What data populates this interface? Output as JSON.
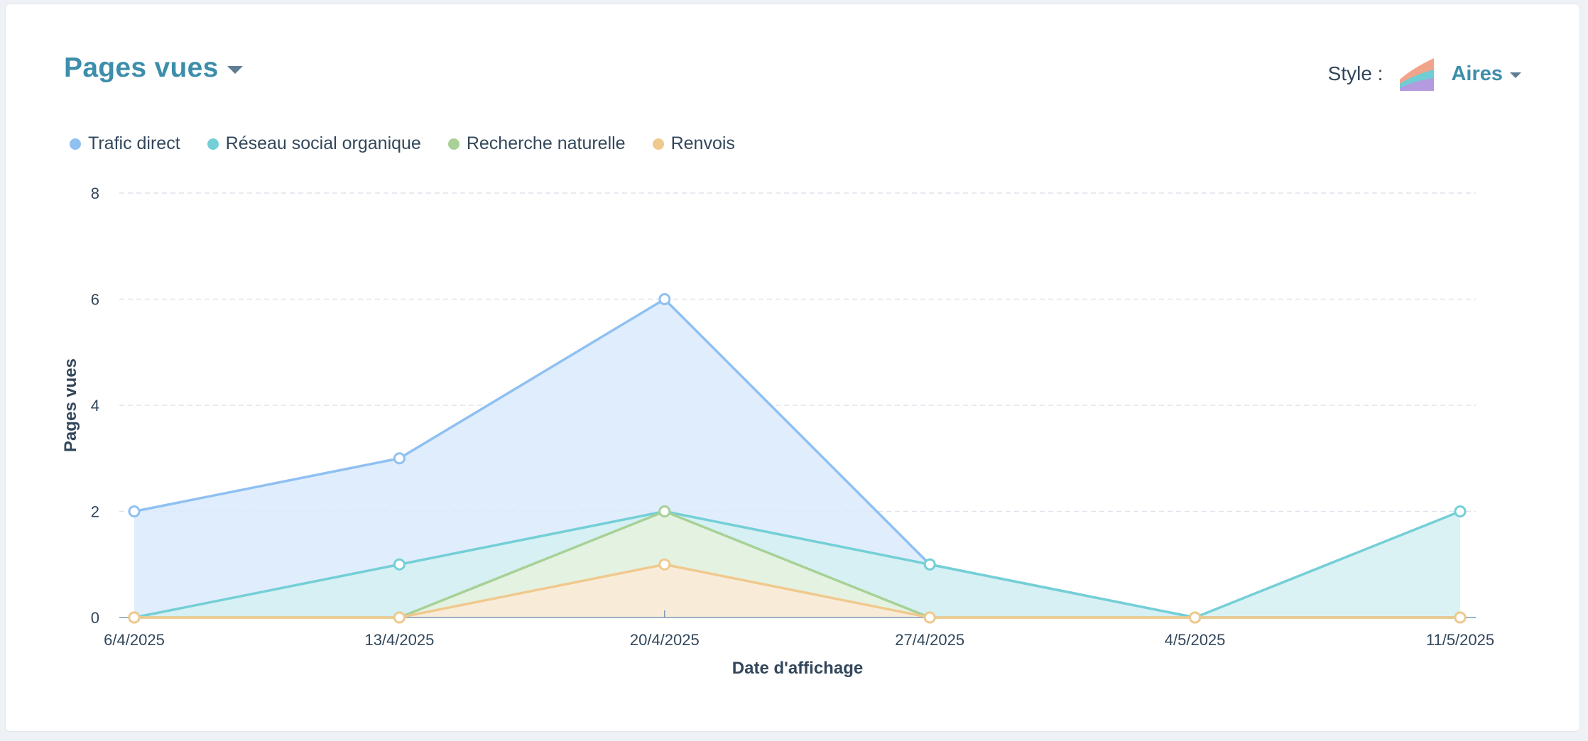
{
  "header": {
    "title": "Pages vues",
    "style_label": "Style :",
    "style_value": "Aires",
    "style_icon": "stacked-area-icon"
  },
  "chart_data": {
    "type": "area",
    "xlabel": "Date d'affichage",
    "ylabel": "Pages vues",
    "categories": [
      "6/4/2025",
      "13/4/2025",
      "20/4/2025",
      "27/4/2025",
      "4/5/2025",
      "11/5/2025"
    ],
    "ylim": [
      0,
      8
    ],
    "yticks": [
      "0",
      "2",
      "4",
      "6",
      "8"
    ],
    "grid": true,
    "legend_position": "top-left",
    "series": [
      {
        "name": "Trafic direct",
        "color": "#8fc0f2",
        "fill": "#dbeafb",
        "values": [
          2,
          3,
          6,
          1,
          0,
          0
        ]
      },
      {
        "name": "Réseau social organique",
        "color": "#74cfd6",
        "fill": "#d4f0f2",
        "values": [
          0,
          1,
          2,
          1,
          0,
          2
        ]
      },
      {
        "name": "Recherche naturelle",
        "color": "#a7d196",
        "fill": "#e6f2de",
        "values": [
          0,
          0,
          2,
          0,
          0,
          0
        ]
      },
      {
        "name": "Renvois",
        "color": "#f0c98e",
        "fill": "#fbebd7",
        "values": [
          0,
          0,
          1,
          0,
          0,
          0
        ]
      }
    ]
  }
}
